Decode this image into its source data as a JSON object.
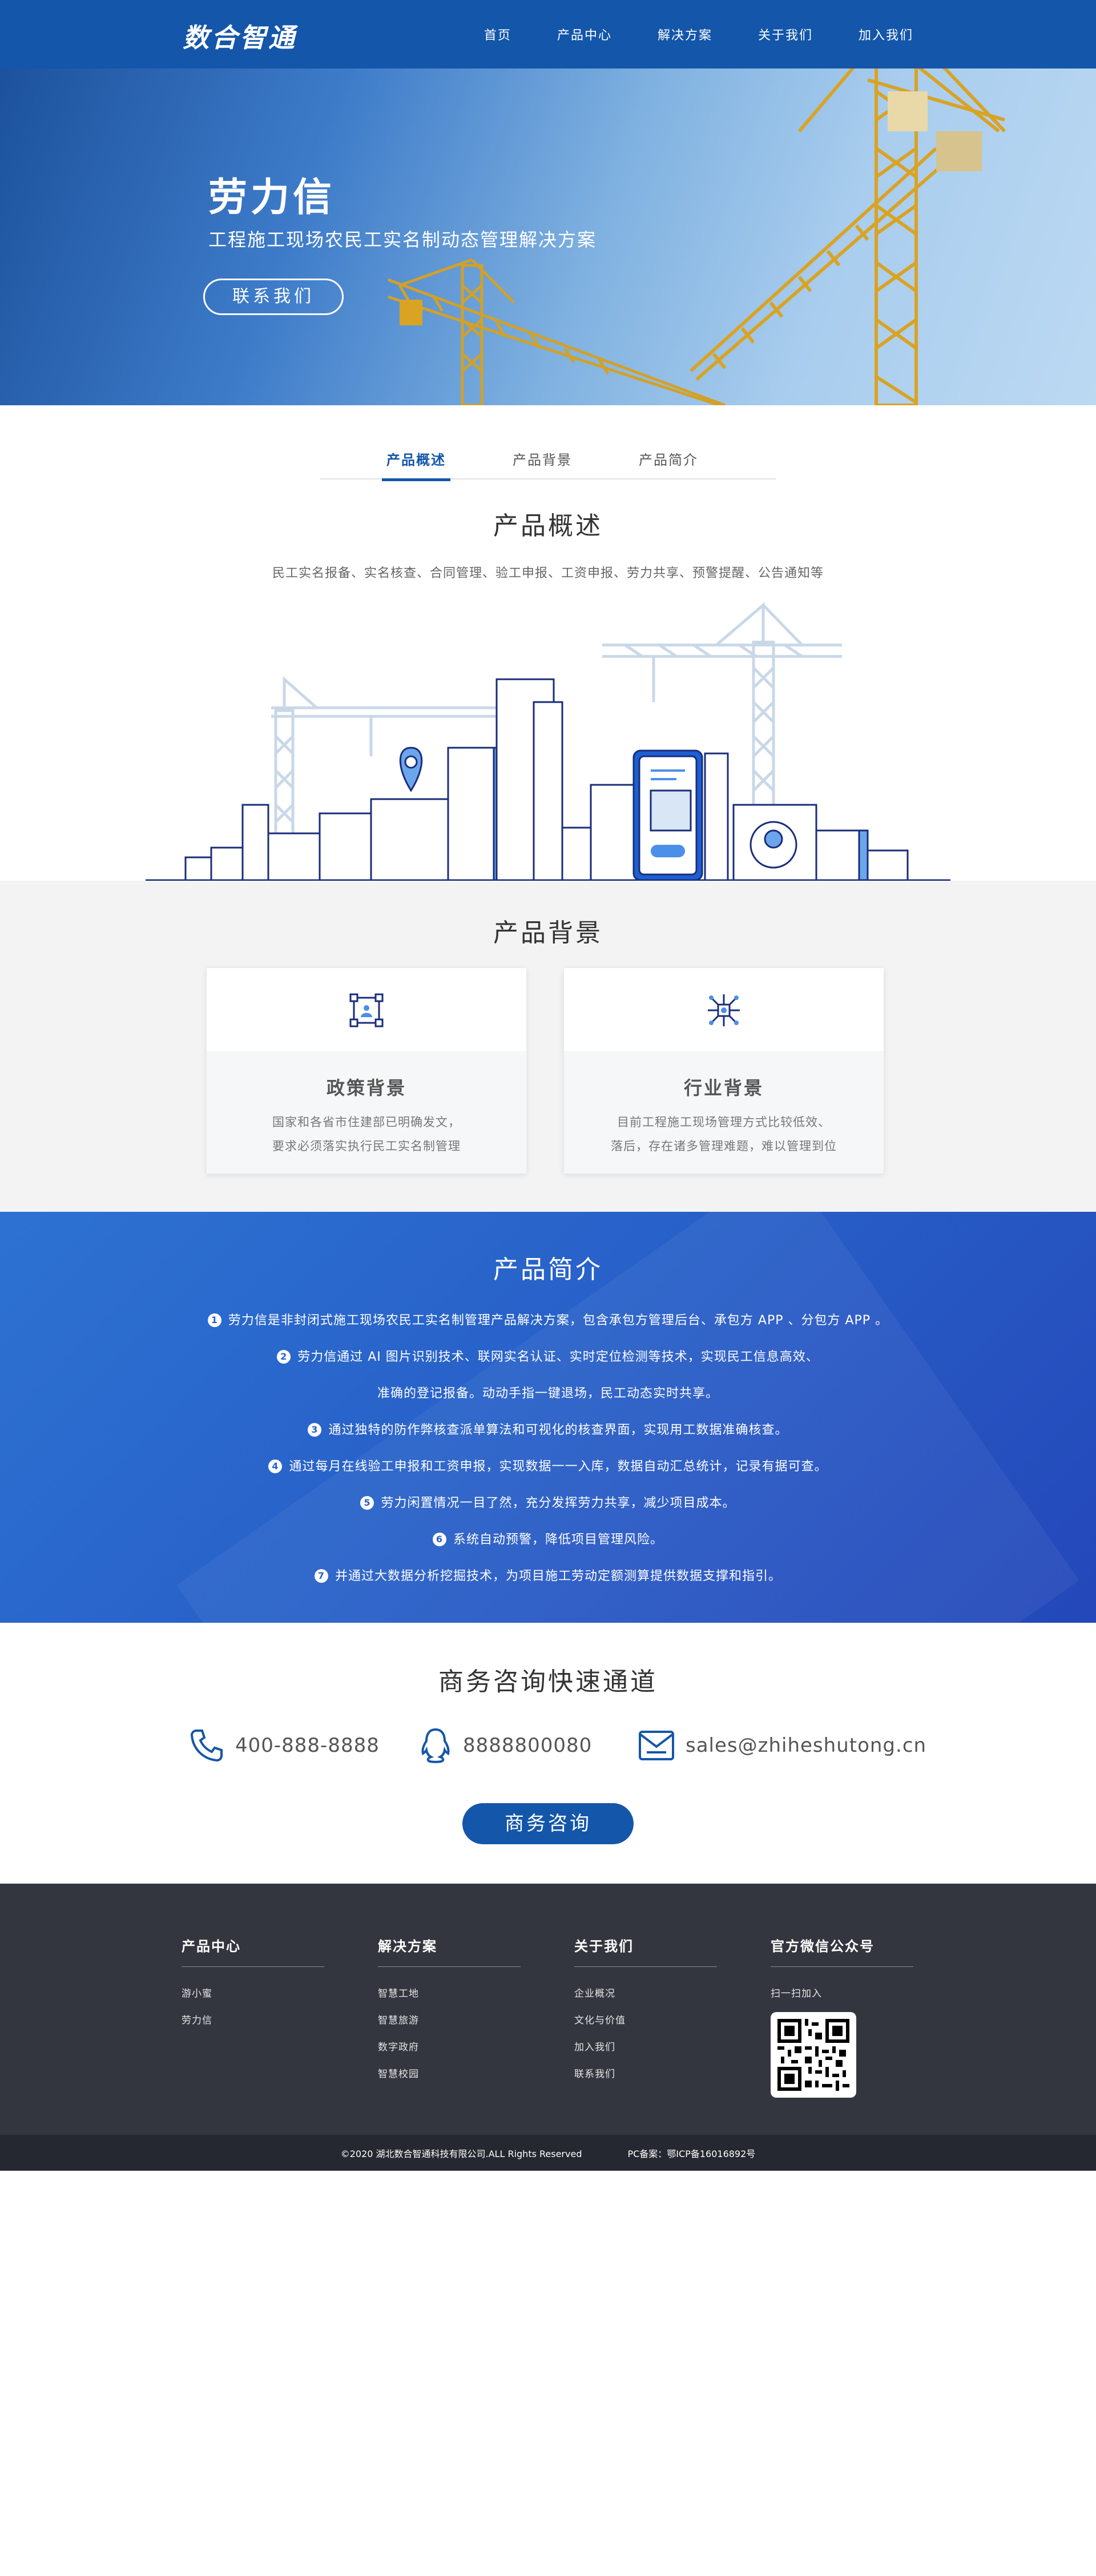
{
  "header": {
    "logo": "数合智通",
    "nav": [
      "首页",
      "产品中心",
      "解决方案",
      "关于我们",
      "加入我们"
    ]
  },
  "hero": {
    "title": "劳力信",
    "subtitle": "工程施工现场农民工实名制动态管理解决方案",
    "cta": "联系我们"
  },
  "tabs": [
    "产品概述",
    "产品背景",
    "产品简介"
  ],
  "overview": {
    "title": "产品概述",
    "subtitle": "民工实名报备、实名核查、合同管理、验工申报、工资申报、劳力共享、预警提醒、公告通知等"
  },
  "background": {
    "title": "产品背景",
    "cards": [
      {
        "icon": "policy-icon",
        "title": "政策背景",
        "lines": [
          "国家和各省市住建部已明确发文，",
          "要求必须落实执行民工实名制管理"
        ]
      },
      {
        "icon": "industry-icon",
        "title": "行业背景",
        "lines": [
          "目前工程施工现场管理方式比较低效、",
          "落后，存在诸多管理难题，难以管理到位"
        ]
      }
    ]
  },
  "intro": {
    "title": "产品简介",
    "items": [
      {
        "num": "1",
        "text": "劳力信是非封闭式施工现场农民工实名制管理产品解决方案，包含承包方管理后台、承包方 APP 、分包方 APP 。"
      },
      {
        "num": "2",
        "text": "劳力信通过 AI 图片识别技术、联网实名认证、实时定位检测等技术，实现民工信息高效、"
      },
      {
        "num": "",
        "text": "准确的登记报备。动动手指一键退场，民工动态实时共享。"
      },
      {
        "num": "3",
        "text": "通过独特的防作弊核查派单算法和可视化的核查界面，实现用工数据准确核查。"
      },
      {
        "num": "4",
        "text": "通过每月在线验工申报和工资申报，实现数据一一入库，数据自动汇总统计，记录有据可查。"
      },
      {
        "num": "5",
        "text": "劳力闲置情况一目了然，充分发挥劳力共享，减少项目成本。"
      },
      {
        "num": "6",
        "text": "系统自动预警，降低项目管理风险。"
      },
      {
        "num": "7",
        "text": "并通过大数据分析挖掘技术，为项目施工劳动定额测算提供数据支撑和指引。"
      }
    ]
  },
  "contact": {
    "title": "商务咨询快速通道",
    "phone": "400-888-8888",
    "qq": "8888800080",
    "email": "sales@zhiheshutong.cn",
    "button": "商务咨询"
  },
  "footer": {
    "columns": [
      {
        "title": "产品中心",
        "links": [
          "游小蜜",
          "劳力信"
        ]
      },
      {
        "title": "解决方案",
        "links": [
          "智慧工地",
          "智慧旅游",
          "数字政府",
          "智慧校园"
        ]
      },
      {
        "title": "关于我们",
        "links": [
          "企业概况",
          "文化与价值",
          "加入我们",
          "联系我们"
        ]
      },
      {
        "title": "官方微信公众号",
        "links": [
          "扫一扫加入"
        ]
      }
    ],
    "copyright": "©2020 湖北数合智通科技有限公司.ALL Rights Reserved",
    "icp": "PC备案：鄂ICP备16016892号"
  },
  "colors": {
    "brand": "#1456a9",
    "intro_bg": "#2861c9",
    "footer": "#33363f"
  }
}
